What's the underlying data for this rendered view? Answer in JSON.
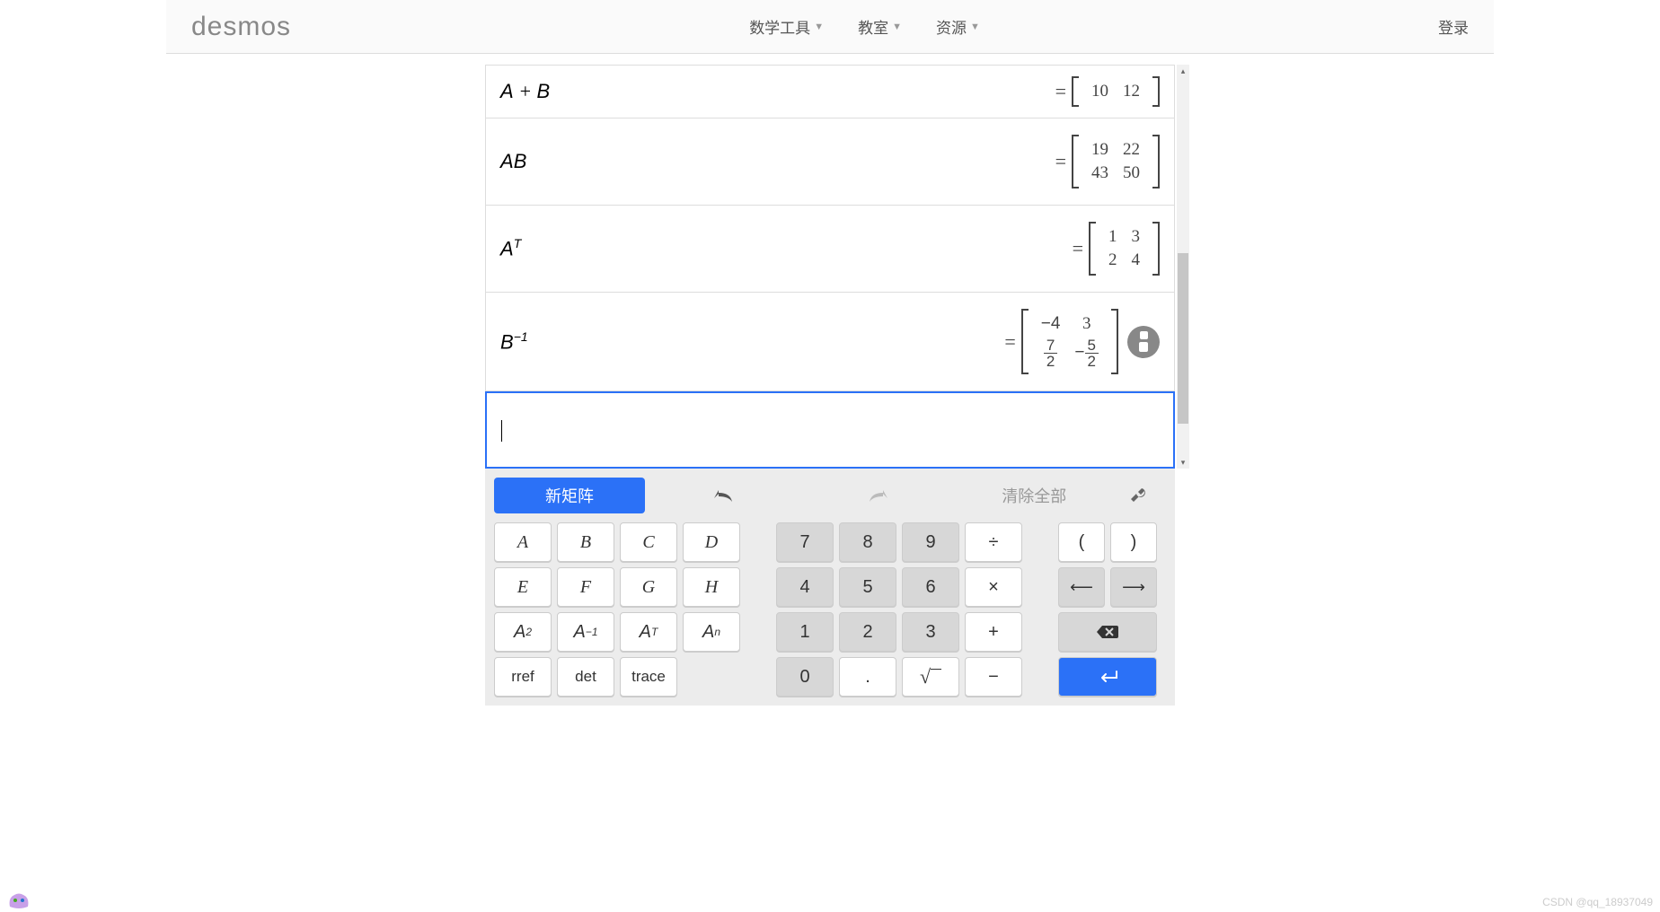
{
  "header": {
    "logo": "desmos",
    "nav": {
      "math_tools": "数学工具",
      "classroom": "教室",
      "resources": "资源"
    },
    "login": "登录"
  },
  "expressions": {
    "r1": {
      "expr_html": "<i>A</i> + <i>B</i>",
      "result": [
        [
          "10",
          "12"
        ]
      ]
    },
    "r2": {
      "expr_html": "<i>A</i><i>B</i>",
      "result": [
        [
          "19",
          "22"
        ],
        [
          "43",
          "50"
        ]
      ]
    },
    "r3": {
      "expr_html": "<i>A</i><span class='sup'>T</span>",
      "result": [
        [
          "1",
          "3"
        ],
        [
          "2",
          "4"
        ]
      ]
    },
    "r4": {
      "expr_html": "<i>B</i><span class='sup'>−1</span>",
      "result_html": "<table><tr><td><span class='neg'>−4</span></td><td>3</td></tr><tr><td><span class='frac'><span class='n'>7</span><span class='d'>2</span></span></td><td><span class='neg'>−</span><span class='frac'><span class='n'>5</span><span class='d'>2</span></span></td></tr></table>"
    }
  },
  "toolbar": {
    "new_matrix": "新矩阵",
    "clear_all": "清除全部"
  },
  "keys": {
    "A": "A",
    "B": "B",
    "C": "C",
    "D": "D",
    "E": "E",
    "F": "F",
    "G": "G",
    "H": "H",
    "A2_html": "<i>A</i><span class='ksup'>2</span>",
    "Ainv_html": "<i>A</i><span class='ksup'>−1</span>",
    "AT_html": "<i>A</i><span class='ksup'>T</span>",
    "An_html": "<i>A</i><span class='ksup'>n</span>",
    "rref": "rref",
    "det": "det",
    "trace": "trace",
    "n7": "7",
    "n8": "8",
    "n9": "9",
    "div": "÷",
    "n4": "4",
    "n5": "5",
    "n6": "6",
    "mul": "×",
    "n1": "1",
    "n2": "2",
    "n3": "3",
    "add": "+",
    "n0": "0",
    "dot": ".",
    "sqrt": "√",
    "sub": "−",
    "lp": "(",
    "rp": ")",
    "left": "⟵",
    "right": "⟶",
    "enter": "↵"
  },
  "watermark": "CSDN @qq_18937049"
}
